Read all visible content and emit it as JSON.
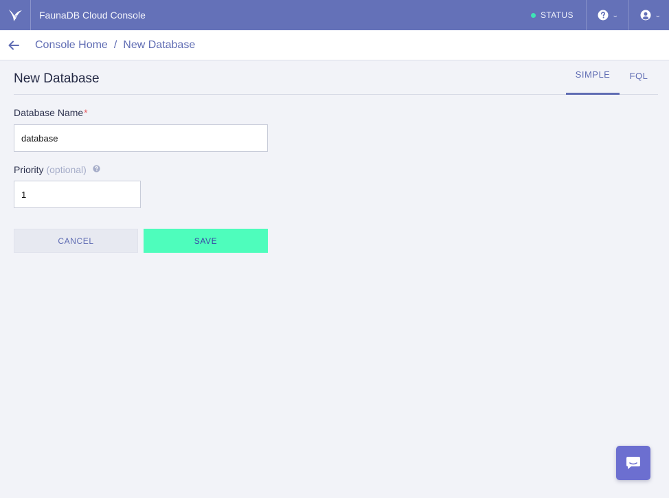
{
  "app": {
    "title": "FaunaDB Cloud Console"
  },
  "topbar": {
    "status_label": "STATUS",
    "status_color": "#3ee5b5",
    "help_icon": "question-circle-icon",
    "account_icon": "user-circle-icon"
  },
  "breadcrumb": {
    "items": [
      "Console Home",
      "New Database"
    ],
    "separator": "/"
  },
  "page": {
    "title": "New Database",
    "tabs": [
      {
        "label": "SIMPLE",
        "active": true
      },
      {
        "label": "FQL",
        "active": false
      }
    ]
  },
  "form": {
    "name_label": "Database Name",
    "required_mark": "*",
    "name_value": "database",
    "priority_label": "Priority",
    "priority_optional": "(optional)",
    "priority_value": "1",
    "cancel_label": "CANCEL",
    "save_label": "SAVE"
  },
  "colors": {
    "topbar": "#6471b8",
    "accent": "#5f6cb3",
    "save_button": "#4efdbc",
    "chat_button": "#6c6fd0"
  }
}
